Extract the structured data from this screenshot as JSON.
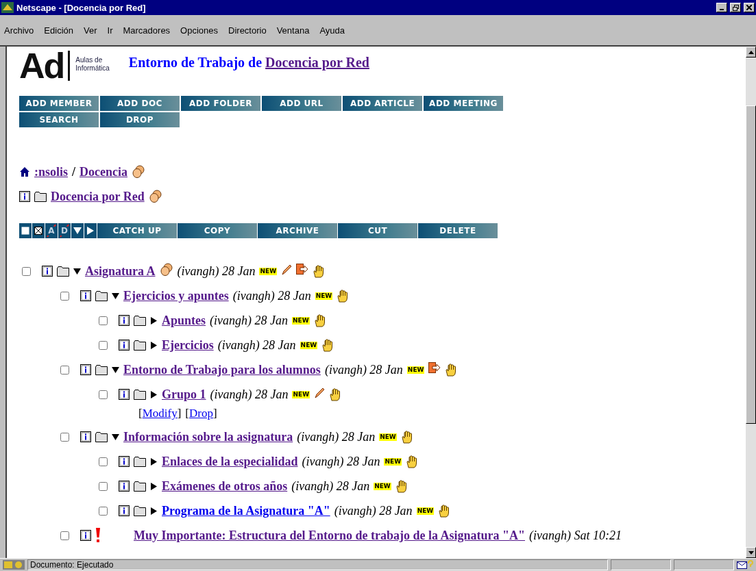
{
  "window": {
    "title": "Netscape - [Docencia por Red]"
  },
  "menu": [
    "Archivo",
    "Edición",
    "Ver",
    "Ir",
    "Marcadores",
    "Opciones",
    "Directorio",
    "Ventana",
    "Ayuda"
  ],
  "logo": {
    "mark": "Ad",
    "caption": [
      "Aulas de",
      "Informática"
    ]
  },
  "header": {
    "prefix": "Entorno de Trabajo de ",
    "link": "Docencia por Red"
  },
  "add_buttons": [
    [
      "ADD MEMBER",
      "ADD DOC",
      "ADD FOLDER",
      "ADD URL",
      "ADD ARTICLE",
      "ADD MEETING"
    ],
    [
      "SEARCH",
      "DROP"
    ]
  ],
  "breadcrumb": {
    "root": ":nsolis",
    "separator": "/",
    "current": "Docencia"
  },
  "folder": {
    "name": "Docencia por Red"
  },
  "action_icons": [
    {
      "kind": "check-all"
    },
    {
      "kind": "check-none"
    },
    {
      "kind": "struck",
      "label": "A"
    },
    {
      "kind": "struck",
      "label": "D"
    },
    {
      "kind": "expand-all"
    },
    {
      "kind": "collapse-all"
    }
  ],
  "action_buttons": [
    "CATCH UP",
    "COPY",
    "ARCHIVE",
    "CUT",
    "DELETE"
  ],
  "tree": [
    {
      "kind": "folder",
      "name": "Asignatura A",
      "checked": false,
      "expanded": true,
      "visited": true,
      "shared": true,
      "byline": "(ivangh) 28 Jan",
      "badge": "NEW",
      "editable": true,
      "movable": true,
      "children": [
        {
          "kind": "folder",
          "name": "Ejercicios y apuntes",
          "checked": false,
          "expanded": true,
          "visited": true,
          "shared": false,
          "byline": "(ivangh) 28 Jan",
          "badge": "NEW",
          "editable": false,
          "movable": false,
          "children": [
            {
              "kind": "folder",
              "name": "Apuntes",
              "checked": false,
              "expanded": false,
              "visited": true,
              "shared": false,
              "byline": "(ivangh) 28 Jan",
              "badge": "NEW",
              "editable": false,
              "movable": false
            },
            {
              "kind": "folder",
              "name": "Ejercicios",
              "checked": false,
              "expanded": false,
              "visited": true,
              "shared": false,
              "byline": "(ivangh) 28 Jan",
              "badge": "NEW",
              "editable": false,
              "movable": false
            }
          ]
        },
        {
          "kind": "folder",
          "name": "Entorno de Trabajo para los alumnos",
          "checked": false,
          "expanded": true,
          "visited": true,
          "shared": false,
          "byline": "(ivangh) 28 Jan",
          "badge": "NEW",
          "editable": false,
          "movable": true,
          "children": [
            {
              "kind": "folder",
              "name": "Grupo 1",
              "checked": false,
              "expanded": false,
              "visited": true,
              "shared": false,
              "byline": "(ivangh) 28 Jan",
              "badge": "NEW",
              "editable": true,
              "movable": false,
              "actions": [
                {
                  "open": "[",
                  "label": "Modify",
                  "close": "]"
                },
                {
                  "open": "[",
                  "label": "Drop",
                  "close": "]"
                }
              ]
            }
          ]
        },
        {
          "kind": "folder",
          "name": "Información sobre la asignatura",
          "checked": false,
          "expanded": true,
          "visited": true,
          "shared": false,
          "byline": "(ivangh) 28 Jan",
          "badge": "NEW",
          "editable": false,
          "movable": false,
          "children": [
            {
              "kind": "folder",
              "name": "Enlaces de la especialidad",
              "checked": false,
              "expanded": false,
              "visited": true,
              "shared": false,
              "byline": "(ivangh) 28 Jan",
              "badge": "NEW",
              "editable": false,
              "movable": false
            },
            {
              "kind": "folder",
              "name": "Exámenes de otros años",
              "checked": false,
              "expanded": false,
              "visited": true,
              "shared": false,
              "byline": "(ivangh) 28 Jan",
              "badge": "NEW",
              "editable": false,
              "movable": false
            },
            {
              "kind": "folder",
              "name": "Programa de la Asignatura \"A\"",
              "checked": false,
              "expanded": false,
              "visited": false,
              "shared": false,
              "byline": "(ivangh) 28 Jan",
              "badge": "NEW",
              "editable": false,
              "movable": false
            }
          ]
        },
        {
          "kind": "note",
          "name": "Muy Importante: Estructura del Entorno de trabajo de la Asignatura \"A\"",
          "checked": false,
          "visited": true,
          "shared": false,
          "byline": "(ivangh) Sat 10:21",
          "editable": false,
          "movable": false
        }
      ]
    }
  ],
  "status_bar": {
    "text": "Documento: Ejecutado"
  }
}
